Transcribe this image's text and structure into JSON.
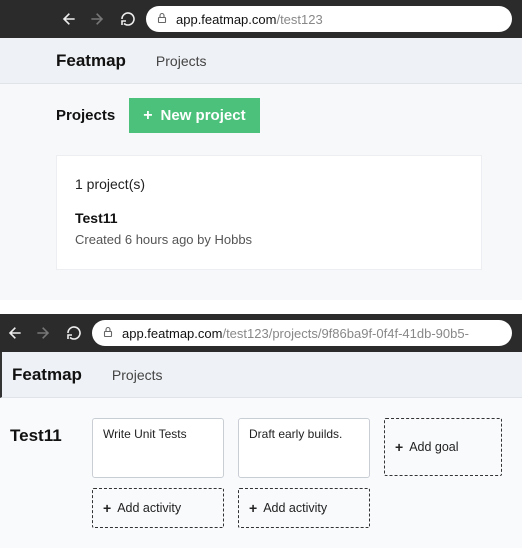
{
  "screens": {
    "first": {
      "url_host": "app.featmap.com",
      "url_path": "/test123",
      "brand": "Featmap",
      "nav_link": "Projects",
      "projects_label": "Projects",
      "new_project_label": "New project",
      "project_count": "1 project(s)",
      "project_name": "Test11",
      "project_meta": "Created 6 hours ago by Hobbs"
    },
    "second": {
      "url_host": "app.featmap.com",
      "url_path": "/test123/projects/9f86ba9f-0f4f-41db-90b5-",
      "brand": "Featmap",
      "nav_link": "Projects",
      "project_title": "Test11",
      "activities": [
        "Write Unit Tests",
        "Draft early builds."
      ],
      "add_activity_label": "Add activity",
      "add_goal_label": "Add goal"
    }
  }
}
